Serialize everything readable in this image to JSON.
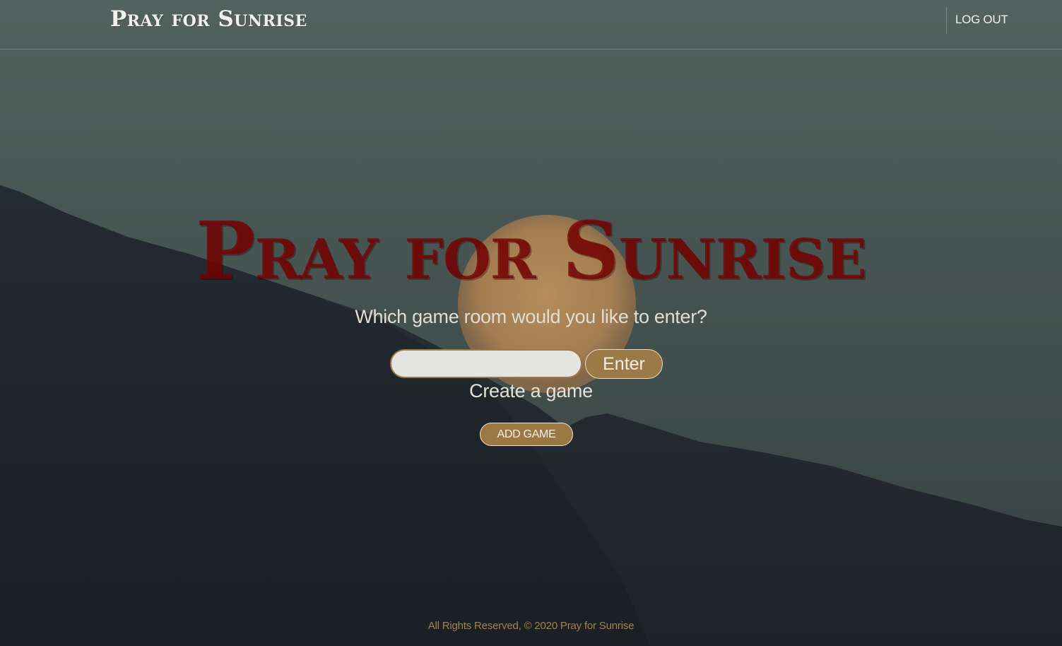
{
  "navbar": {
    "brand": "Pray for Sunrise",
    "logout_label": "LOG OUT"
  },
  "hero": {
    "title": "Pray for Sunrise",
    "question": "Which game room would you like to enter?",
    "room_input_value": "",
    "room_input_placeholder": "",
    "enter_label": "Enter",
    "create_label": "Create a game",
    "add_game_label": "ADD GAME"
  },
  "footer": {
    "text": "All Rights Reserved, © 2020 Pray for Sunrise"
  },
  "colors": {
    "accent_gold": "#9b7a47",
    "title_red": "#780000",
    "sky": "#52625e",
    "mountain": "#1e2428"
  }
}
